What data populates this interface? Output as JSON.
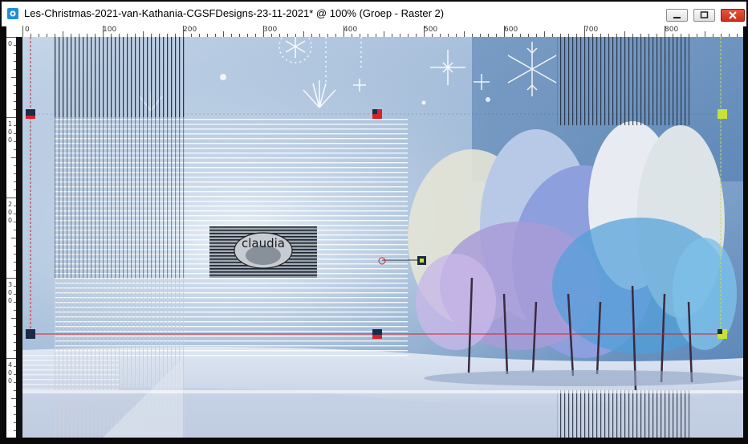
{
  "window": {
    "title": "Les-Christmas-2021-van-Kathania-CGSFDesigns-23-11-2021* @ 100% (Groep - Raster 2)",
    "controls": [
      "minimize-icon",
      "maximize-icon",
      "close-icon"
    ]
  },
  "ruler": {
    "top_labels": [
      "0",
      "100",
      "200",
      "300",
      "400",
      "500",
      "600",
      "700",
      "800"
    ],
    "left_labels": [
      "0",
      "100",
      "200",
      "300",
      "400"
    ]
  },
  "canvas": {
    "watermark_text": "claudia",
    "colors": {
      "sky": "#9fbad8",
      "snow": "#e8eef8",
      "selection_red": "#d2232a",
      "node_dark": "#1c2b45",
      "node_yellow": "#c8e03a"
    }
  }
}
